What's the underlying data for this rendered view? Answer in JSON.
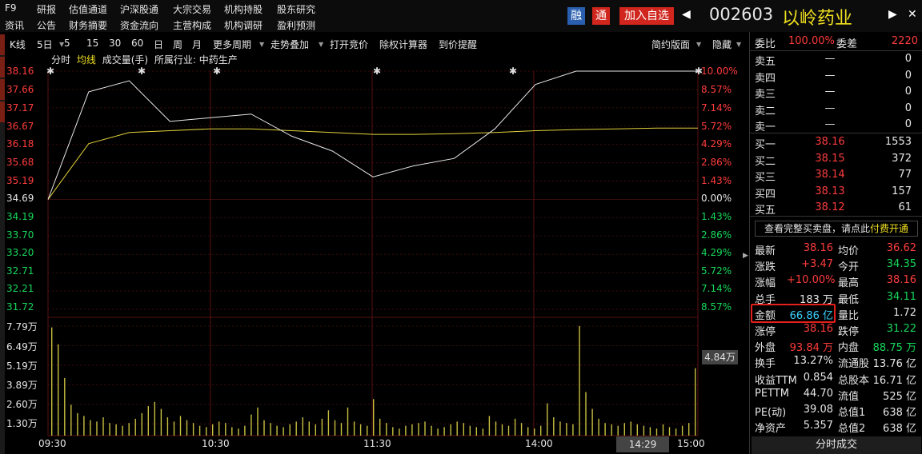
{
  "menu_row1": [
    "F9",
    "研报",
    "估值通道",
    "沪深股通",
    "大宗交易",
    "机构持股",
    "股东研究"
  ],
  "menu_row2": [
    "资讯",
    "公告",
    "财务摘要",
    "资金流向",
    "主营构成",
    "机构调研",
    "盈利预测"
  ],
  "badges": {
    "rong": "融",
    "tong": "通",
    "add": "加入自选"
  },
  "stock": {
    "code": "002603",
    "name": "以岭药业"
  },
  "toolbar": [
    "K线",
    "5日",
    "5",
    "15",
    "30",
    "60",
    "日",
    "周",
    "月",
    "更多周期",
    "走势叠加",
    "打开竞价",
    "除权计算器",
    "到价提醒"
  ],
  "toolbar_right": [
    "简约版面",
    "隐藏"
  ],
  "subbar": {
    "fenshi": "分时",
    "junxian": "均线",
    "volume": "成交量(手)",
    "industry": "所属行业: 中药生产"
  },
  "price_axis": [
    "38.16",
    "37.66",
    "37.17",
    "36.67",
    "36.18",
    "35.68",
    "35.19",
    "34.69",
    "34.19",
    "33.70",
    "33.20",
    "32.71",
    "32.21",
    "31.72"
  ],
  "pct_axis": [
    "10.00%",
    "8.57%",
    "7.14%",
    "5.72%",
    "4.29%",
    "2.86%",
    "1.43%",
    "0.00%",
    "1.43%",
    "2.86%",
    "4.29%",
    "5.72%",
    "7.14%",
    "8.57%"
  ],
  "vol_axis": [
    "7.79万",
    "6.49万",
    "5.19万",
    "3.89万",
    "2.60万",
    "1.30万"
  ],
  "vol_badge": "4.84万",
  "time_axis": [
    "09:30",
    "10:30",
    "11:30",
    "14:00",
    "14:29",
    "15:00"
  ],
  "chart_data": {
    "type": "line",
    "x": [
      "09:30",
      "09:45",
      "10:00",
      "10:15",
      "10:30",
      "10:45",
      "11:00",
      "11:15",
      "11:30",
      "13:15",
      "13:30",
      "13:45",
      "14:00",
      "14:15",
      "14:30",
      "14:45",
      "15:00"
    ],
    "series": [
      {
        "values": [
          34.69,
          37.6,
          37.9,
          36.8,
          36.9,
          37.0,
          36.4,
          36.0,
          35.3,
          35.6,
          35.8,
          36.6,
          37.8,
          38.16,
          38.16,
          38.16,
          38.16
        ]
      },
      {
        "values": [
          34.69,
          36.2,
          36.5,
          36.55,
          36.6,
          36.6,
          36.55,
          36.5,
          36.45,
          36.45,
          36.47,
          36.5,
          36.55,
          36.58,
          36.6,
          36.62,
          36.62
        ]
      }
    ],
    "volume": [
      7.7,
      6.5,
      4.1,
      2.2,
      1.6,
      1.4,
      1.1,
      1.0,
      1.3,
      0.9,
      0.8,
      0.7,
      0.9,
      1.2,
      1.6,
      2.1,
      2.4,
      1.9,
      1.3,
      1.0,
      1.4,
      1.1,
      0.9,
      0.7,
      0.6,
      0.8,
      1.0,
      0.9,
      0.6,
      0.5,
      0.7,
      1.5,
      2.0,
      1.1,
      0.9,
      0.7,
      0.6,
      0.8,
      1.0,
      1.3,
      1.0,
      0.8,
      1.2,
      1.8,
      1.1,
      0.9,
      2.0,
      1.0,
      0.8,
      0.7,
      2.6,
      1.2,
      0.9,
      0.6,
      0.5,
      0.7,
      0.8,
      0.9,
      1.0,
      0.7,
      0.5,
      0.6,
      0.8,
      1.0,
      0.9,
      0.7,
      0.6,
      0.5,
      1.4,
      1.0,
      0.8,
      0.7,
      1.2,
      0.9,
      0.6,
      0.5,
      0.7,
      2.3,
      1.3,
      1.0,
      0.9,
      0.8,
      7.8,
      3.1,
      1.9,
      1.2,
      0.9,
      0.8,
      0.7,
      0.9,
      1.0,
      0.8,
      0.7,
      0.6,
      0.5,
      0.8,
      0.6,
      0.5,
      0.7,
      0.9,
      4.8
    ],
    "ylim": [
      31.72,
      38.16
    ],
    "vol_max": 7.79
  },
  "book": {
    "weibi_l": "委比",
    "weibi_v": "100.00%",
    "weicha_l": "委差",
    "weicha_v": "2220",
    "asks": [
      {
        "l": "卖五",
        "p": "—",
        "v": "0"
      },
      {
        "l": "卖四",
        "p": "—",
        "v": "0"
      },
      {
        "l": "卖三",
        "p": "—",
        "v": "0"
      },
      {
        "l": "卖二",
        "p": "—",
        "v": "0"
      },
      {
        "l": "卖一",
        "p": "—",
        "v": "0"
      }
    ],
    "bids": [
      {
        "l": "买一",
        "p": "38.16",
        "v": "1553"
      },
      {
        "l": "买二",
        "p": "38.15",
        "v": "372"
      },
      {
        "l": "买三",
        "p": "38.14",
        "v": "77"
      },
      {
        "l": "买四",
        "p": "38.13",
        "v": "157"
      },
      {
        "l": "买五",
        "p": "38.12",
        "v": "61"
      }
    ],
    "promo": "查看完整买卖盘，请点此",
    "promo_link": "付费开通"
  },
  "quote": [
    {
      "a": "最新",
      "av": "38.16",
      "ac": "r",
      "b": "均价",
      "bv": "36.62",
      "bc": "r"
    },
    {
      "a": "涨跌",
      "av": "+3.47",
      "ac": "r",
      "b": "今开",
      "bv": "34.35",
      "bc": "g"
    },
    {
      "a": "涨幅",
      "av": "+10.00%",
      "ac": "r",
      "b": "最高",
      "bv": "38.16",
      "bc": "r"
    },
    {
      "a": "总手",
      "av": "183 万",
      "ac": "w",
      "b": "最低",
      "bv": "34.11",
      "bc": "g"
    },
    {
      "a": "金额",
      "av": "66.86 亿",
      "ac": "c",
      "b": "量比",
      "bv": "1.72",
      "bc": "w"
    },
    {
      "a": "涨停",
      "av": "38.16",
      "ac": "r",
      "b": "跌停",
      "bv": "31.22",
      "bc": "g"
    },
    {
      "a": "外盘",
      "av": "93.84 万",
      "ac": "r",
      "b": "内盘",
      "bv": "88.75 万",
      "bc": "g"
    },
    {
      "a": "换手",
      "av": "13.27%",
      "ac": "w",
      "b": "流通股",
      "bv": "13.76 亿",
      "bc": "w"
    },
    {
      "a": "收益TTM",
      "av": "0.854",
      "ac": "w",
      "b": "总股本",
      "bv": "16.71 亿",
      "bc": "w"
    },
    {
      "a": "PETTM",
      "av": "44.70",
      "ac": "w",
      "b": "流值",
      "bv": "525 亿",
      "bc": "w"
    },
    {
      "a": "PE(动)",
      "av": "39.08",
      "ac": "w",
      "b": "总值1",
      "bv": "638 亿",
      "bc": "w"
    },
    {
      "a": "净资产",
      "av": "5.357",
      "ac": "w",
      "b": "总值2",
      "bv": "638 亿",
      "bc": "w"
    }
  ],
  "bottom_tab": "分时成交",
  "colors": {
    "up": "#ff3c3c",
    "down": "#16d75a",
    "price_line": "#e6e6e6",
    "avg_line": "#e3d23c",
    "volume": "#c8c040",
    "highlight": "#e3201b"
  }
}
